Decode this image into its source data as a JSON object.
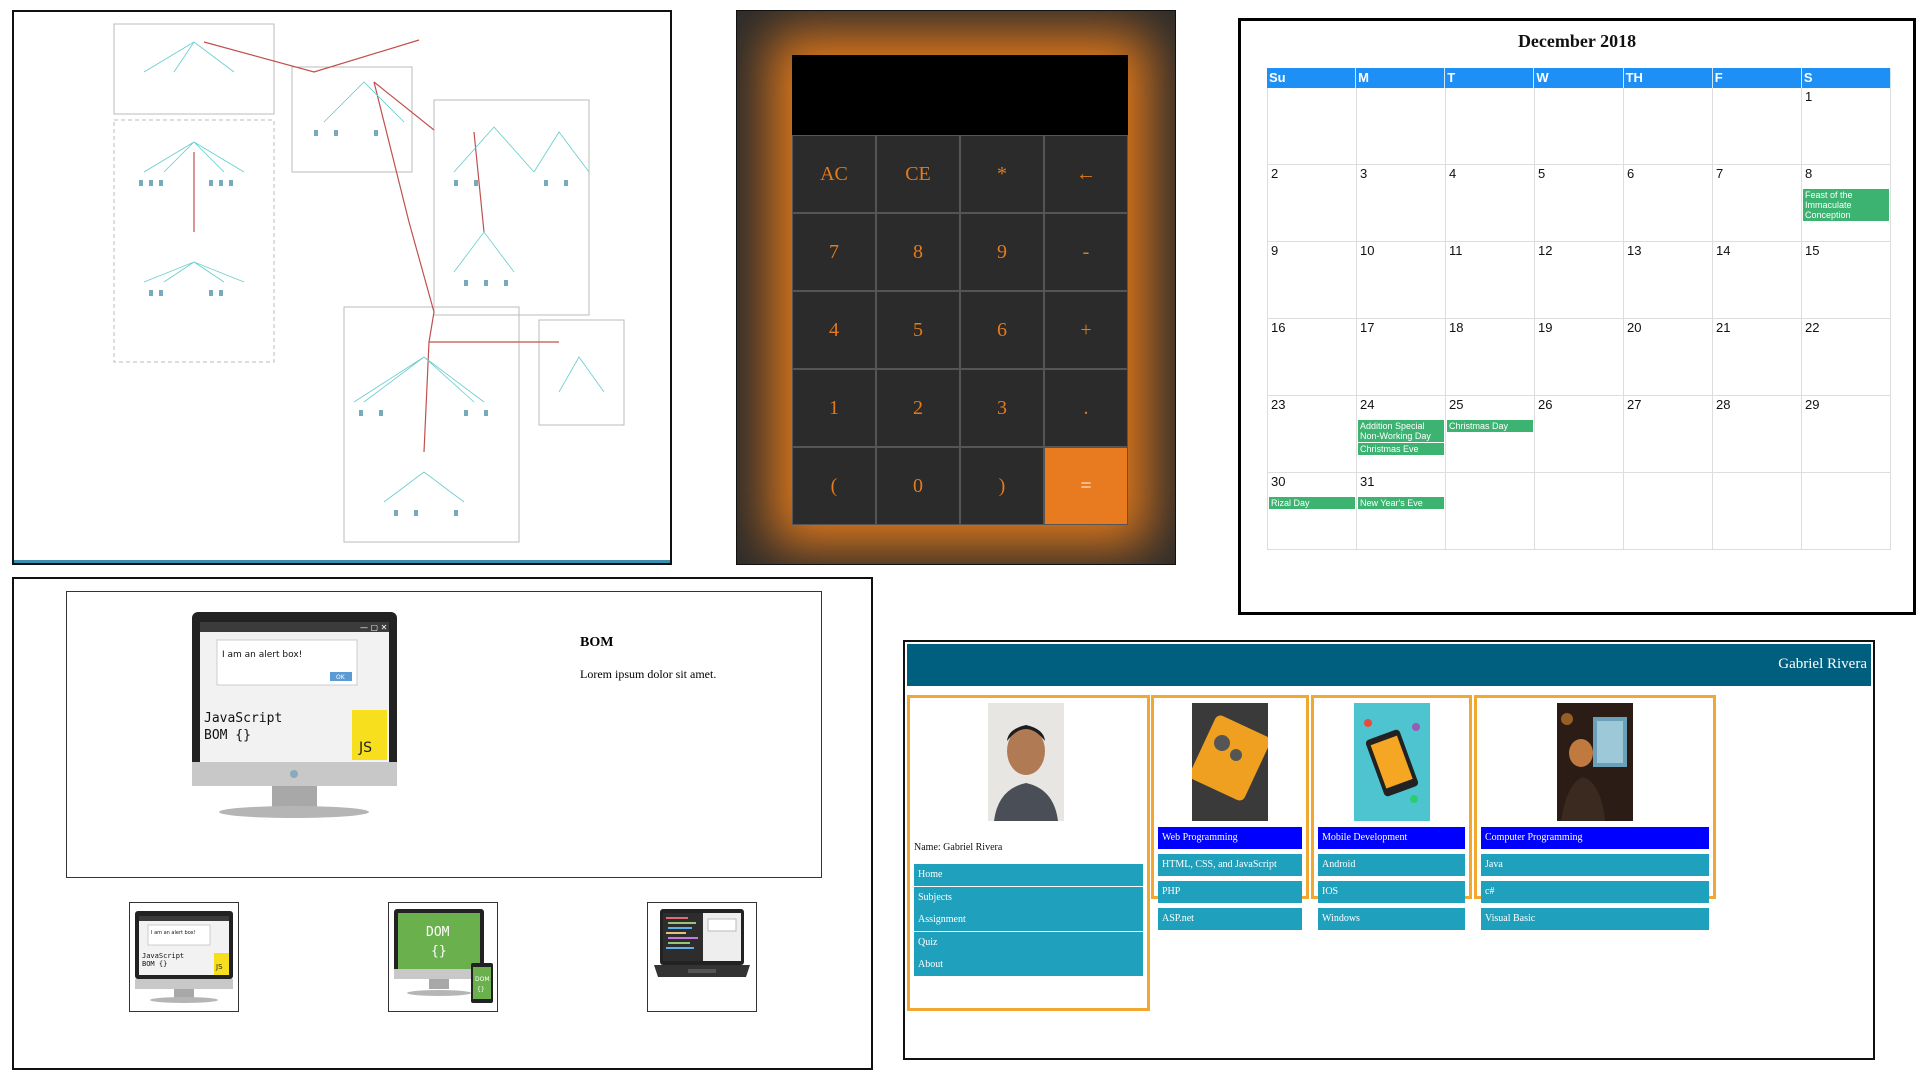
{
  "calculator": {
    "keys": [
      "AC",
      "CE",
      "*",
      "←",
      "7",
      "8",
      "9",
      "-",
      "4",
      "5",
      "6",
      "+",
      "1",
      "2",
      "3",
      ".",
      "(",
      "0",
      ")",
      "="
    ],
    "accent": "#e47a1b"
  },
  "calendar": {
    "title": "December 2018",
    "weekdays": [
      "Su",
      "M",
      "T",
      "W",
      "TH",
      "F",
      "S"
    ],
    "days": [
      "",
      "",
      "",
      "",
      "",
      "",
      "1",
      "2",
      "3",
      "4",
      "5",
      "6",
      "7",
      "8",
      "9",
      "10",
      "11",
      "12",
      "13",
      "14",
      "15",
      "16",
      "17",
      "18",
      "19",
      "20",
      "21",
      "22",
      "23",
      "24",
      "25",
      "26",
      "27",
      "28",
      "29",
      "30",
      "31",
      "",
      "",
      "",
      "",
      ""
    ],
    "events": [
      {
        "day": "8",
        "label": "Feast of the Immaculate Conception"
      },
      {
        "day": "24",
        "label": "Addition Special Non-Working Day"
      },
      {
        "day": "24",
        "label": "Christmas Eve"
      },
      {
        "day": "25",
        "label": "Christmas Day"
      },
      {
        "day": "30",
        "label": "Rizal Day"
      },
      {
        "day": "31",
        "label": "New Year's Eve"
      }
    ],
    "header_color": "#1e90f5",
    "event_color": "#3cb371"
  },
  "bom": {
    "title": "BOM",
    "text": "Lorem ipsum dolor sit amet.",
    "alert_text": "I am an alert box!",
    "ok_label": "OK",
    "screen_line1": "JavaScript",
    "screen_line2": "BOM {}",
    "js_badge": "JS",
    "dom_line1": "DOM",
    "dom_line2": "{}"
  },
  "portfolio": {
    "name": "Gabriel Rivera",
    "profile_caption": "Name: Gabriel Rivera",
    "menu": [
      "Home",
      "Subjects",
      "Assignment",
      "Quiz",
      "About"
    ],
    "cards": [
      {
        "heading": "Web Programming",
        "items": [
          "HTML, CSS, and JavaScript",
          "PHP",
          "ASP.net"
        ]
      },
      {
        "heading": "Mobile Development",
        "items": [
          "Android",
          "IOS",
          "Windows"
        ]
      },
      {
        "heading": "Computer Programming",
        "items": [
          "Java",
          "c#",
          "Visual Basic"
        ]
      }
    ],
    "header_color": "#005f7f",
    "border_color": "#f0a830"
  }
}
